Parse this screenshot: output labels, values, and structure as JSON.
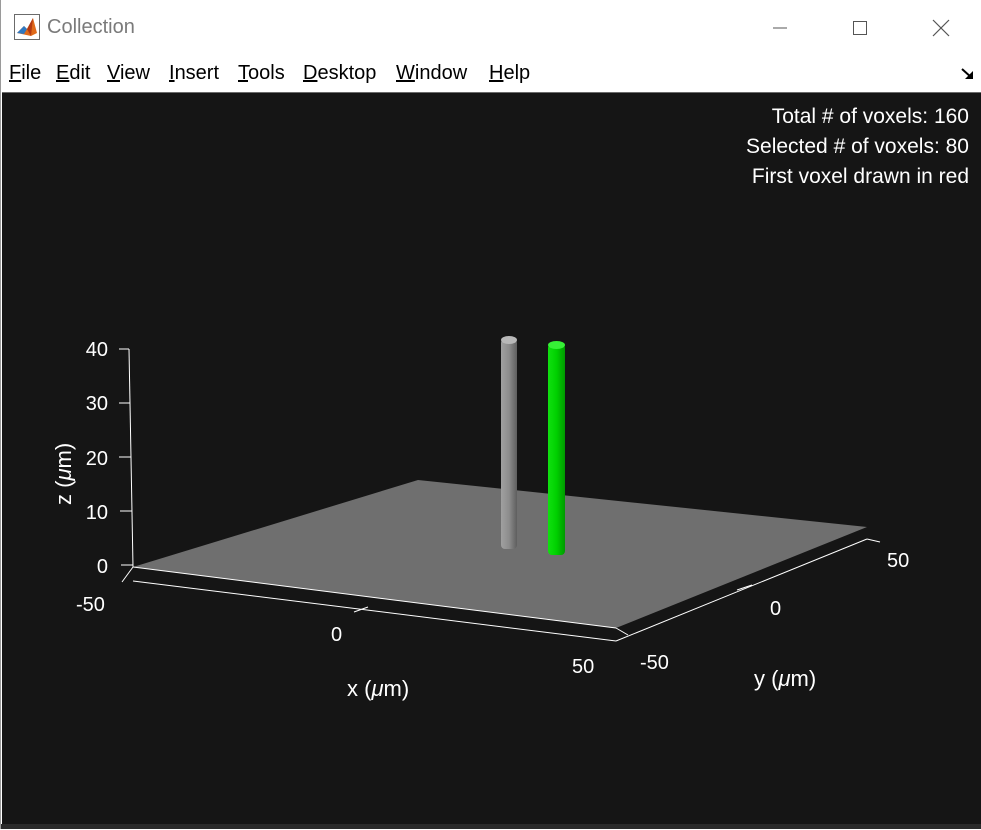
{
  "window": {
    "title": "Collection",
    "controls": {
      "minimize": "minimize-icon",
      "maximize": "maximize-icon",
      "close": "close-icon"
    }
  },
  "menubar": {
    "items": [
      {
        "label": "File",
        "accel": "F",
        "rest": "ile"
      },
      {
        "label": "Edit",
        "accel": "E",
        "rest": "dit"
      },
      {
        "label": "View",
        "accel": "V",
        "rest": "iew"
      },
      {
        "label": "Insert",
        "accel": "I",
        "rest": "nsert"
      },
      {
        "label": "Tools",
        "accel": "T",
        "rest": "ools"
      },
      {
        "label": "Desktop",
        "accel": "D",
        "rest": "esktop"
      },
      {
        "label": "Window",
        "accel": "W",
        "rest": "indow"
      },
      {
        "label": "Help",
        "accel": "H",
        "rest": "elp"
      }
    ],
    "dock_icon": "dock-arrow-icon"
  },
  "figure": {
    "background": "#151515",
    "info": [
      "Total # of voxels: 160",
      "Selected # of voxels: 80",
      "First voxel drawn in red"
    ]
  },
  "plot": {
    "z_ticks": [
      "40",
      "30",
      "20",
      "10",
      "0"
    ],
    "x_ticks": [
      "-50",
      "0",
      "50"
    ],
    "y_ticks": [
      "-50",
      "0",
      "50"
    ],
    "xlabel_prefix": "x (",
    "xlabel_mu": "μ",
    "xlabel_suffix": "m)",
    "ylabel_prefix": "y (",
    "ylabel_mu": "μ",
    "ylabel_suffix": "m)",
    "zlabel_prefix": "z (",
    "zlabel_mu": "μ",
    "zlabel_suffix": "m)",
    "colors": {
      "floor": "#6f6f6f",
      "gray_column": "#8a8a8a",
      "green_column": "#00d000",
      "axis": "#ffffff"
    }
  }
}
